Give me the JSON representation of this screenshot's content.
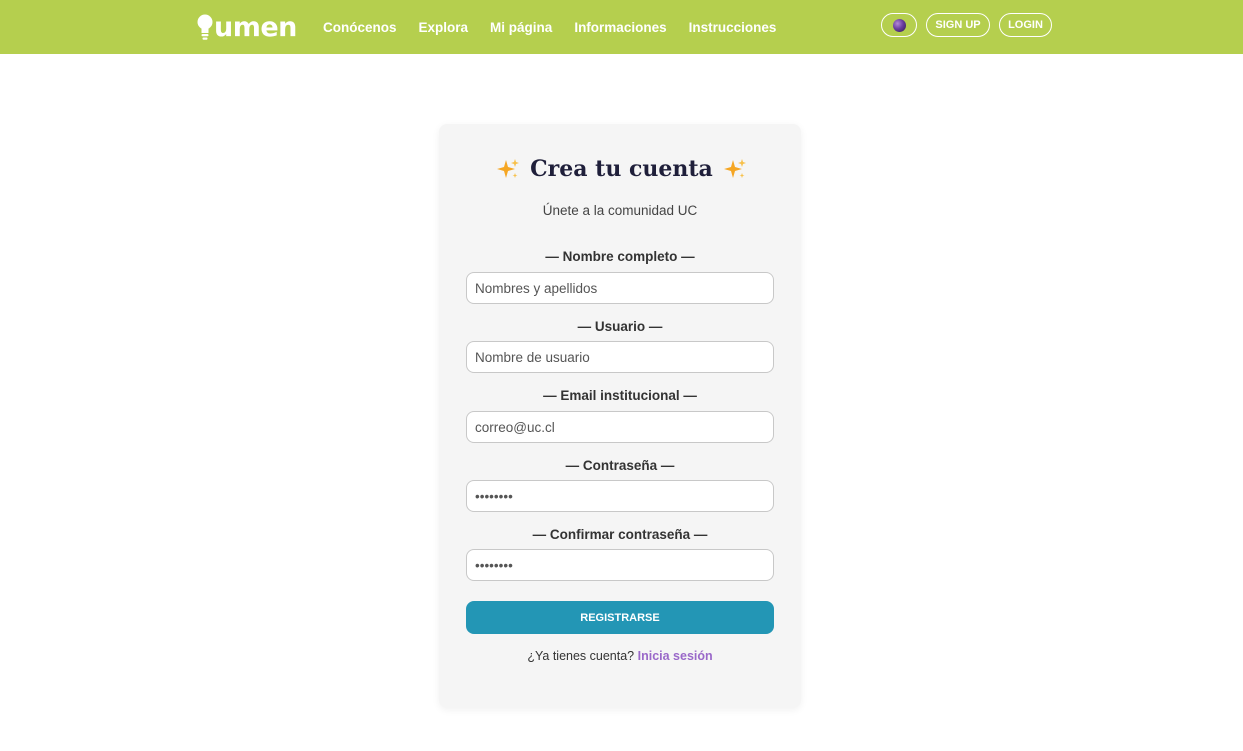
{
  "header": {
    "logo_text": "umen",
    "nav": [
      "Conócenos",
      "Explora",
      "Mi página",
      "Informaciones",
      "Instrucciones"
    ],
    "signup_label": "SIGN UP",
    "login_label": "LOGIN"
  },
  "form": {
    "title": "Crea tu cuenta",
    "subtitle": "Únete a la comunidad UC",
    "fields": [
      {
        "label": "— Nombre completo —",
        "placeholder": "Nombres y apellidos",
        "value": ""
      },
      {
        "label": "— Usuario —",
        "placeholder": "Nombre de usuario",
        "value": ""
      },
      {
        "label": "— Email institucional —",
        "placeholder": "correo@uc.cl",
        "value": ""
      },
      {
        "label": "— Contraseña —",
        "placeholder": "••••••••",
        "value": ""
      },
      {
        "label": "— Confirmar contraseña —",
        "placeholder": "••••••••",
        "value": ""
      }
    ],
    "submit_label": "REGISTRARSE",
    "footer_text": "¿Ya tienes cuenta?",
    "footer_link": "Inicia sesión"
  },
  "colors": {
    "header_bg": "#b5cf4e",
    "primary_button": "#2396b5",
    "link": "#9a68c9",
    "sparkle": "#f5a623"
  },
  "icons": {
    "logo": "lightbulb-icon",
    "theme": "moon-icon",
    "title_decoration": "sparkles-icon"
  }
}
